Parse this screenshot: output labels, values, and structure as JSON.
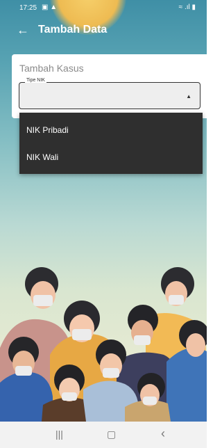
{
  "status_bar": {
    "time": "17:25",
    "icons_left": "▣ ▲",
    "icons_right": "≈ .ıl ▮"
  },
  "app_bar": {
    "back_icon": "arrow-left-icon",
    "title": "Tambah Data"
  },
  "card": {
    "title": "Tambah Kasus",
    "select": {
      "label": "Tipe NIK",
      "value": "",
      "dropdown_icon": "triangle-up-icon"
    }
  },
  "dropdown": {
    "options": [
      "NIK Pribadi",
      "NIK Wali"
    ]
  },
  "nav_bar": {
    "recent": "|||",
    "home": "▢",
    "back": "‹"
  },
  "colors": {
    "sky_top": "#3f8fa6",
    "sun": "#eebb52",
    "menu_bg": "#2f2f2f",
    "card_bg": "#ffffff"
  }
}
